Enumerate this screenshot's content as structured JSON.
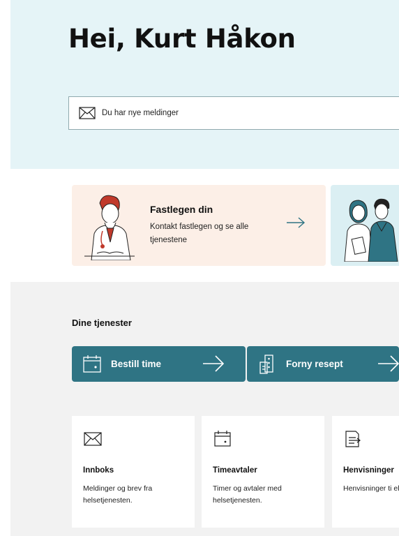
{
  "greeting": "Hei, Kurt Håkon",
  "messages_banner": {
    "text": "Du har nye meldinger",
    "icon": "envelope-icon"
  },
  "fastlege_card": {
    "title": "Fastlegen din",
    "description": "Kontakt fastlegen og se alle tjenestene",
    "icon": "arrow-right-icon"
  },
  "services": {
    "heading": "Dine tjenester",
    "buttons": [
      {
        "label": "Bestill time",
        "icon": "calendar-icon"
      },
      {
        "label": "Forny resept",
        "icon": "prescription-icon"
      }
    ],
    "tiles": [
      {
        "title": "Innboks",
        "description": "Meldinger og brev fra helsetjenesten.",
        "icon": "envelope-icon"
      },
      {
        "title": "Timeavtaler",
        "description": "Timer og avtaler med helsetjenesten.",
        "icon": "calendar-icon"
      },
      {
        "title": "Henvisninger",
        "description": "Henvisninger ti eller spesialist.",
        "icon": "referral-document-icon"
      }
    ]
  },
  "colors": {
    "hero_background": "#e5f4f7",
    "fastlege_card_background": "#fcefe7",
    "teal_card_background": "#dbeff3",
    "button_background": "#2f7484",
    "services_background": "#f2f2f2"
  }
}
